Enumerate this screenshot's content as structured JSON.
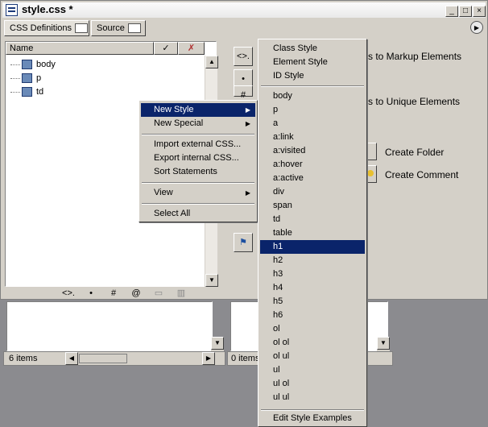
{
  "window": {
    "title": "style.css *",
    "controls": [
      "_",
      "□",
      "×"
    ]
  },
  "tabs": [
    {
      "label": "CSS Definitions",
      "icon": "css-definitions-icon"
    },
    {
      "label": "Source",
      "icon": "source-icon"
    }
  ],
  "tree": {
    "column_header": "Name",
    "items": [
      "body",
      "p",
      "td"
    ],
    "check_col_icon": "✓",
    "x_col_icon": "✗"
  },
  "tree_toolbar": {
    "icons": [
      "<>.",
      "•",
      "#",
      "@",
      "doc",
      "trash"
    ]
  },
  "vertical_toolbar": {
    "icons": [
      "<>.",
      "•",
      "#",
      "flag"
    ]
  },
  "right_panel": {
    "markup_text": "s to Markup Elements",
    "unique_text": "s to Unique Elements",
    "create_folder": "Create Folder",
    "create_comment": "Create Comment"
  },
  "lower": {
    "left_status": "6 items",
    "right_status": "0 items"
  },
  "context_menu": {
    "items": [
      {
        "label": "New Style",
        "submenu": true,
        "highlighted": true
      },
      {
        "label": "New Special",
        "submenu": true
      },
      {
        "label": "Import external CSS..."
      },
      {
        "label": "Export internal CSS..."
      },
      {
        "label": "Sort Statements"
      },
      {
        "label": "View",
        "submenu": true
      },
      {
        "label": "Select All"
      }
    ]
  },
  "submenu": {
    "top_items": [
      "Class Style",
      "Element Style",
      "ID Style"
    ],
    "elements": [
      "body",
      "p",
      "a",
      "a:link",
      "a:visited",
      "a:hover",
      "a:active",
      "div",
      "span",
      "td",
      "table",
      "h1",
      "h2",
      "h3",
      "h4",
      "h5",
      "h6",
      "ol",
      "ol ol",
      "ol ul",
      "ul",
      "ul ol",
      "ul ul"
    ],
    "highlighted": "h1",
    "footer": "Edit Style Examples"
  },
  "colors": {
    "selection": "#0a246a",
    "face": "#d4d0c8",
    "desktop": "#8b8b8f"
  }
}
